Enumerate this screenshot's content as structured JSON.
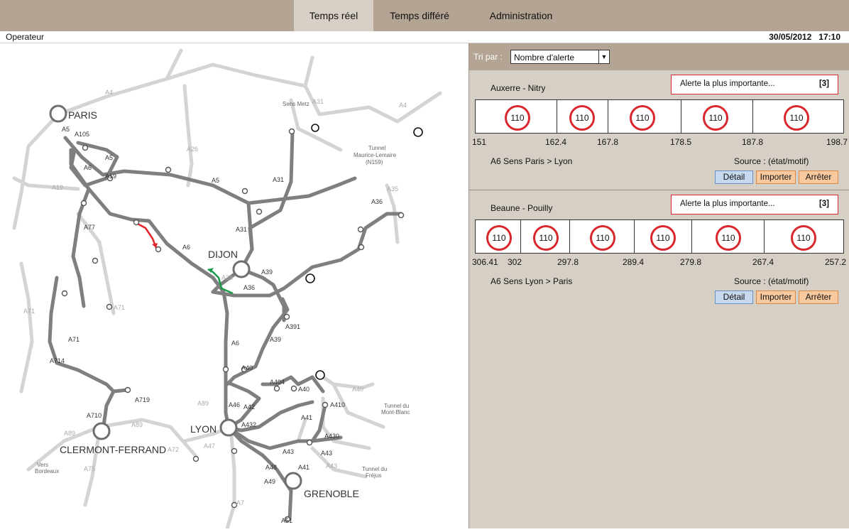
{
  "tabs": [
    {
      "label": "Temps réel",
      "active": true
    },
    {
      "label": "Temps différé",
      "active": false
    },
    {
      "label": "Administration",
      "active": false
    }
  ],
  "status": {
    "operator": "Operateur",
    "date": "30/05/2012",
    "time": "17:10"
  },
  "map": {
    "cities": {
      "paris": "PARIS",
      "dijon": "DIJON",
      "lyon": "LYON",
      "clermont": "CLERMONT-FERRAND",
      "grenoble": "GRENOBLE"
    },
    "roads": {
      "a4": "A4",
      "a5": "A5",
      "a105": "A105",
      "a6": "A6",
      "a19": "A19",
      "a26": "A26",
      "a31": "A31",
      "a35": "A35",
      "a36": "A36",
      "a38": "A38",
      "a39": "A39",
      "a391": "A391",
      "a40": "A40",
      "a404": "A404",
      "a41": "A41",
      "a410": "A410",
      "a42": "A42",
      "a43": "A43",
      "a430": "A430",
      "a432": "A432",
      "a46": "A46",
      "a47": "A47",
      "a48": "A48",
      "a49": "A49",
      "a51": "A51",
      "a7": "A7",
      "a71": "A71",
      "a714": "A714",
      "a710": "A710",
      "a719": "A719",
      "a72": "A72",
      "a75": "A75",
      "a77": "A77",
      "a89": "A89"
    },
    "notes": {
      "sens_metz": "Sens Metz",
      "tunnel_maurice": "Tunnel",
      "tunnel_maurice2": "Maurice-Lemaire",
      "tunnel_maurice3": "(N159)",
      "tunnel_mb": "Tunnel du",
      "tunnel_mb2": "Mont-Blanc",
      "tunnel_frejus": "Tunnel du",
      "tunnel_frejus2": "Fréjus",
      "vers_bordeaux": "Vers",
      "vers_bordeaux2": "Bordeaux"
    }
  },
  "sort": {
    "label": "Tri par :",
    "value": "Nombre d'alerte"
  },
  "cards": [
    {
      "title": "Auxerre - Nitry",
      "alert_text": "Alerte la plus importante...",
      "alert_count": "[3]",
      "signs": [
        "110",
        "110",
        "110",
        "110",
        "110"
      ],
      "km": [
        "151",
        "162.4",
        "167.8",
        "178.5",
        "187.8",
        "198.7"
      ],
      "direction": "A6 Sens Paris > Lyon",
      "source": "Source : (état/motif)",
      "buttons": {
        "detail": "Détail",
        "import": "Importer",
        "stop": "Arrêter"
      }
    },
    {
      "title": "Beaune - Pouilly",
      "alert_text": "Alerte la plus importante...",
      "alert_count": "[3]",
      "signs": [
        "110",
        "110",
        "110",
        "110",
        "110",
        "110"
      ],
      "km": [
        "306.41",
        "302",
        "297.8",
        "289.4",
        "279.8",
        "267.4",
        "257.2"
      ],
      "direction": "A6 Sens Lyon > Paris",
      "source": "Source : (état/motif)",
      "buttons": {
        "detail": "Détail",
        "import": "Importer",
        "stop": "Arrêter"
      }
    }
  ],
  "colors": {
    "header": "#b3a493",
    "panel": "#d6cfc5",
    "alert": "#d9272d",
    "road": "#7f7f7f",
    "road_light": "#cfcfcf",
    "segment_red": "#e3262b",
    "segment_green": "#1a9a4a"
  }
}
